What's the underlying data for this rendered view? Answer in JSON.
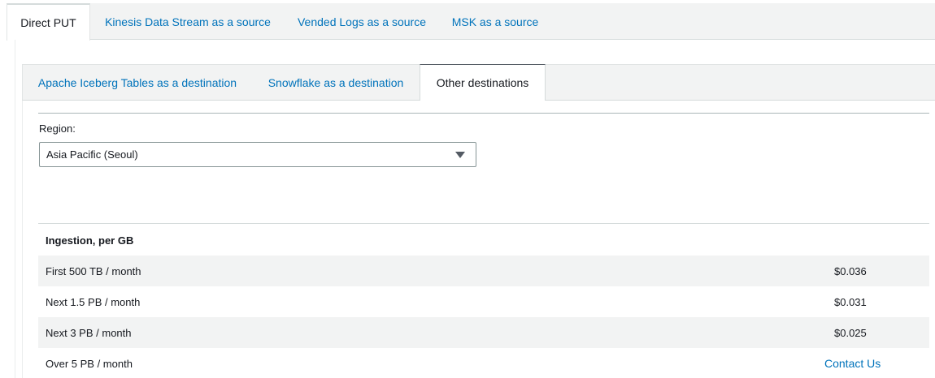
{
  "source_tabs": [
    {
      "label": "Direct PUT",
      "active": true
    },
    {
      "label": "Kinesis Data Stream as a source",
      "active": false
    },
    {
      "label": "Vended Logs as a source",
      "active": false
    },
    {
      "label": "MSK as a source",
      "active": false
    }
  ],
  "destination_tabs": [
    {
      "label": "Apache Iceberg Tables as a destination",
      "active": false
    },
    {
      "label": "Snowflake as a destination",
      "active": false
    },
    {
      "label": "Other destinations",
      "active": true
    }
  ],
  "region": {
    "label": "Region:",
    "selected": "Asia Pacific (Seoul)"
  },
  "pricing_table": {
    "header": "Ingestion, per GB",
    "rows": [
      {
        "tier": "First 500 TB / month",
        "price": "$0.036"
      },
      {
        "tier": "Next 1.5 PB / month",
        "price": "$0.031"
      },
      {
        "tier": "Next 3 PB / month",
        "price": "$0.025"
      },
      {
        "tier": "Over 5 PB / month",
        "price": "Contact Us"
      }
    ]
  },
  "colors": {
    "link": "#0073bb",
    "text": "#16191f",
    "tab_bar_bg": "#f2f3f3",
    "row_shade": "#f2f3f3"
  }
}
